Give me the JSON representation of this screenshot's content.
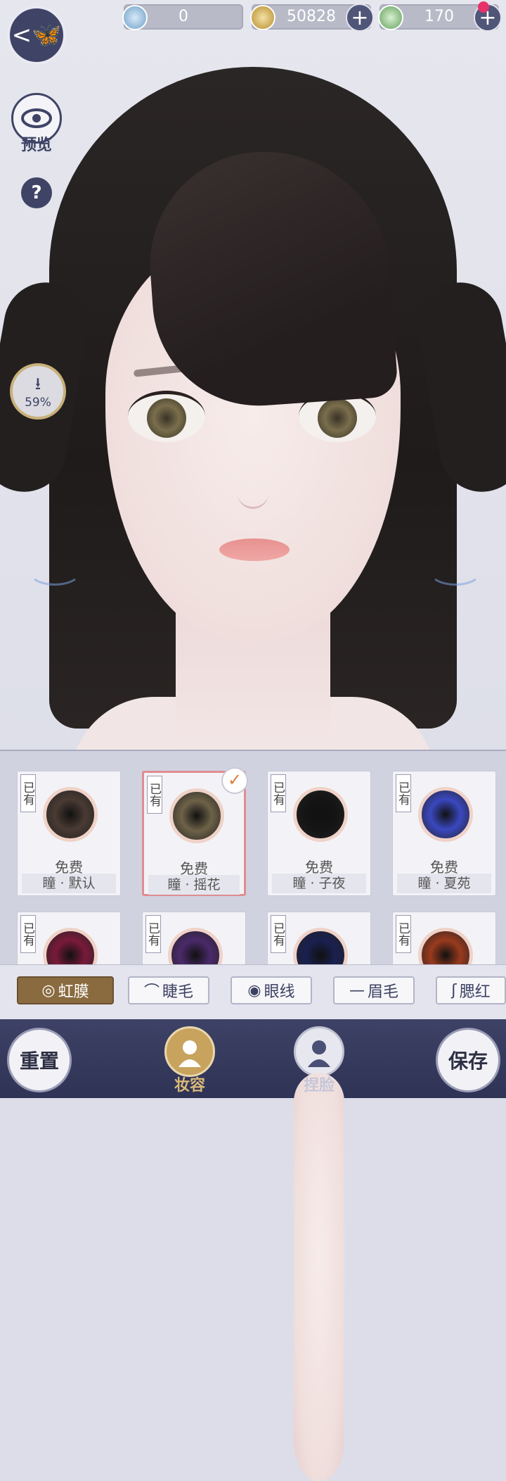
{
  "topbar": {
    "resources": [
      {
        "name": "jade",
        "value": "0",
        "icon": "jade-coin-icon"
      },
      {
        "name": "copper",
        "value": "50828",
        "icon": "copper-coin-icon"
      },
      {
        "name": "stamina",
        "value": "170",
        "icon": "green-gem-icon"
      }
    ]
  },
  "side": {
    "preview_label": "预览",
    "help_label": "?",
    "download_progress": "59%"
  },
  "items": [
    {
      "tag": "已有",
      "price": "免费",
      "name": "瞳 · 默认",
      "color": "#4a3a33",
      "selected": false
    },
    {
      "tag": "已有",
      "price": "免费",
      "name": "瞳 · 摇花",
      "color": "#6e6248",
      "selected": true
    },
    {
      "tag": "已有",
      "price": "免费",
      "name": "瞳 · 子夜",
      "color": "#141414",
      "selected": false
    },
    {
      "tag": "已有",
      "price": "免费",
      "name": "瞳 · 夏苑",
      "color": "#3a48c0",
      "selected": false
    },
    {
      "tag": "已有",
      "price": "",
      "name": "",
      "color": "#7a1a3a",
      "selected": false
    },
    {
      "tag": "已有",
      "price": "",
      "name": "",
      "color": "#4a2a6a",
      "selected": false
    },
    {
      "tag": "已有",
      "price": "",
      "name": "",
      "color": "#1a2050",
      "selected": false
    },
    {
      "tag": "已有",
      "price": "",
      "name": "",
      "color": "#9a3a1e",
      "selected": false
    }
  ],
  "tabs": [
    {
      "label": "虹膜",
      "icon": "◎",
      "active": true
    },
    {
      "label": "睫毛",
      "icon": "⌒",
      "active": false
    },
    {
      "label": "眼线",
      "icon": "◉",
      "active": false
    },
    {
      "label": "眉毛",
      "icon": "—",
      "active": false
    },
    {
      "label": "腮红",
      "icon": "ʃ",
      "active": false
    }
  ],
  "bottom": {
    "reset_label": "重置",
    "makeup_label": "妆容",
    "face_label": "捏脸",
    "save_label": "保存"
  }
}
